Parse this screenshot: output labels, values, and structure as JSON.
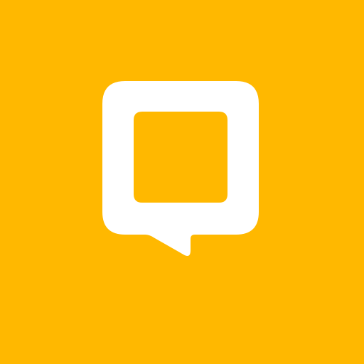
{
  "icon": {
    "name": "speech-bubble-square-icon",
    "background_color": "#FFB800",
    "foreground_color": "#FFFFFF"
  }
}
